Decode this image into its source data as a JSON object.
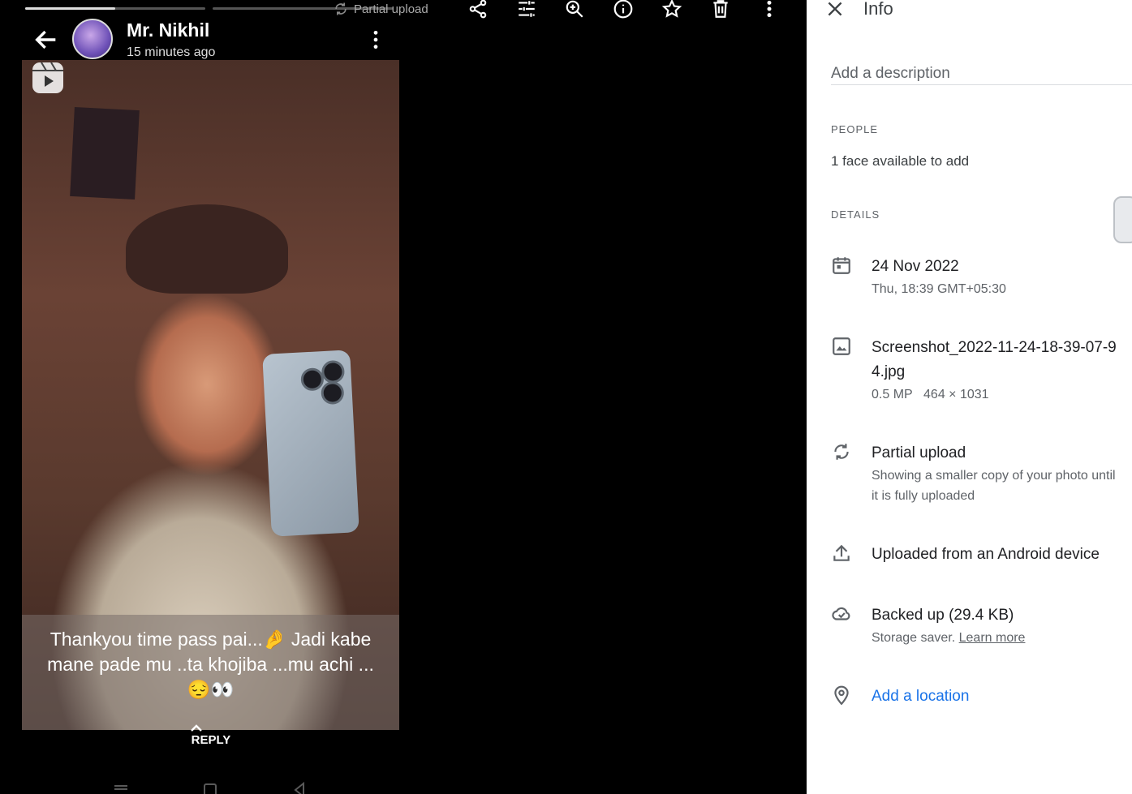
{
  "colors": {
    "viewer_bg": "#000000",
    "panel_bg": "#ffffff",
    "link": "#1a73e8",
    "secondary_text": "#5f6368"
  },
  "viewer": {
    "upload_status": "Partial upload",
    "story_progress": [
      0.5,
      0.0
    ],
    "toolbar": [
      {
        "name": "share",
        "icon": "share-icon"
      },
      {
        "name": "edit",
        "icon": "tune-icon"
      },
      {
        "name": "zoom",
        "icon": "zoom-in-icon"
      },
      {
        "name": "info",
        "icon": "info-icon"
      },
      {
        "name": "favorite",
        "icon": "star-icon"
      },
      {
        "name": "delete",
        "icon": "trash-icon"
      },
      {
        "name": "more",
        "icon": "more-vert-icon"
      }
    ],
    "story": {
      "user_name": "Mr. Nikhil",
      "time_ago": "15 minutes ago",
      "caption_line1": "Thankyou time pass pai...🤌 Jadi kabe",
      "caption_line2": "mane pade mu ..ta khojiba ...mu achi ...",
      "caption_line3": "😔👀",
      "reply_label": "REPLY"
    }
  },
  "info_panel": {
    "title": "Info",
    "description_placeholder": "Add a description",
    "people_label": "PEOPLE",
    "faces_text": "1 face available to add",
    "details_label": "DETAILS",
    "date": {
      "main": "24 Nov 2022",
      "sub": "Thu, 18:39   GMT+05:30"
    },
    "file": {
      "name": "Screenshot_2022-11-24-18-39-07-94.jpg",
      "megapixels": "0.5 MP",
      "dimensions": "464 × 1031"
    },
    "upload": {
      "main": "Partial upload",
      "sub": "Showing a smaller copy of your photo until it is fully uploaded"
    },
    "source": {
      "main": "Uploaded from an Android device"
    },
    "backup": {
      "main": "Backed up (29.4 KB)",
      "sub_prefix": "Storage saver. ",
      "learn_more": "Learn more"
    },
    "location": {
      "add_label": "Add a location"
    }
  }
}
